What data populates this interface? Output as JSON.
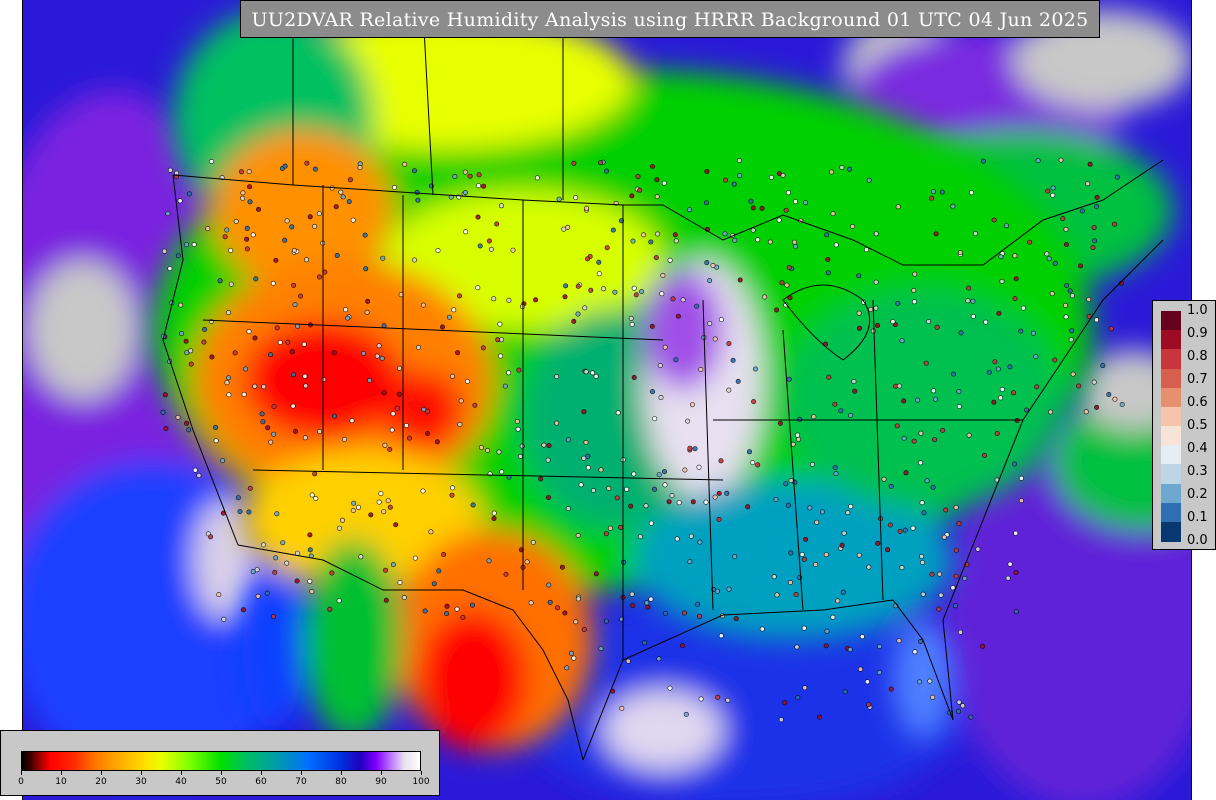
{
  "title": "UU2DVAR Relative Humidity Analysis using HRRR Background 01 UTC 04 Jun 2025",
  "legend_rh": {
    "ticks": [
      "0",
      "10",
      "20",
      "30",
      "40",
      "50",
      "60",
      "70",
      "80",
      "90",
      "100"
    ]
  },
  "legend_obs": {
    "labels": [
      "1.0",
      "0.9",
      "0.8",
      "0.7",
      "0.6",
      "0.5",
      "0.4",
      "0.3",
      "0.2",
      "0.1",
      "0.0"
    ],
    "colors": [
      "#67001f",
      "#9e0b25",
      "#c8353b",
      "#d6604d",
      "#e6906f",
      "#f5c4aa",
      "#f7e4d8",
      "#e6eef3",
      "#bcd6e6",
      "#6ea8cf",
      "#2d6fb0",
      "#083870"
    ]
  },
  "colors": {
    "panel_bg": "#c8c8c8",
    "title_bg": "#8c8c8c",
    "ocean_humid": "#2a1ad8",
    "very_humid": "#8a22e0",
    "dry": "#ff0000",
    "moderate": "#00d000"
  }
}
